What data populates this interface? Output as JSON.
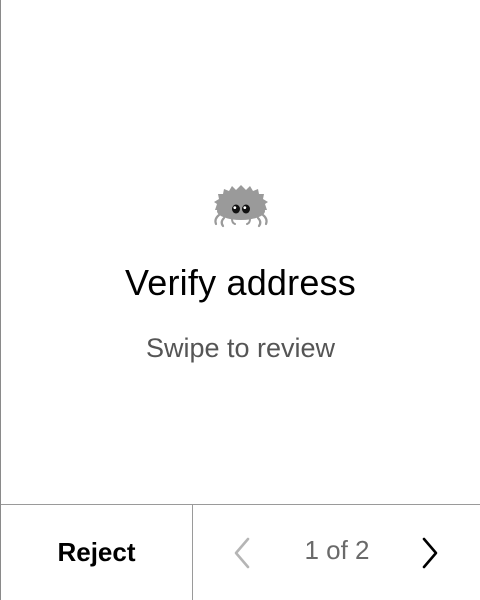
{
  "card": {
    "icon": "crab-icon",
    "title": "Verify address",
    "subtitle": "Swipe to review"
  },
  "footer": {
    "reject_label": "Reject",
    "page_indicator": "1 of 2",
    "prev_icon": "chevron-left-icon",
    "next_icon": "chevron-right-icon"
  },
  "colors": {
    "background": "#ffffff",
    "title": "#000000",
    "subtitle": "#555555",
    "divider": "#9a9a9a",
    "chevron_disabled": "#b5b5b5",
    "chevron_enabled": "#000000",
    "icon_gray": "#9a9a9a"
  }
}
